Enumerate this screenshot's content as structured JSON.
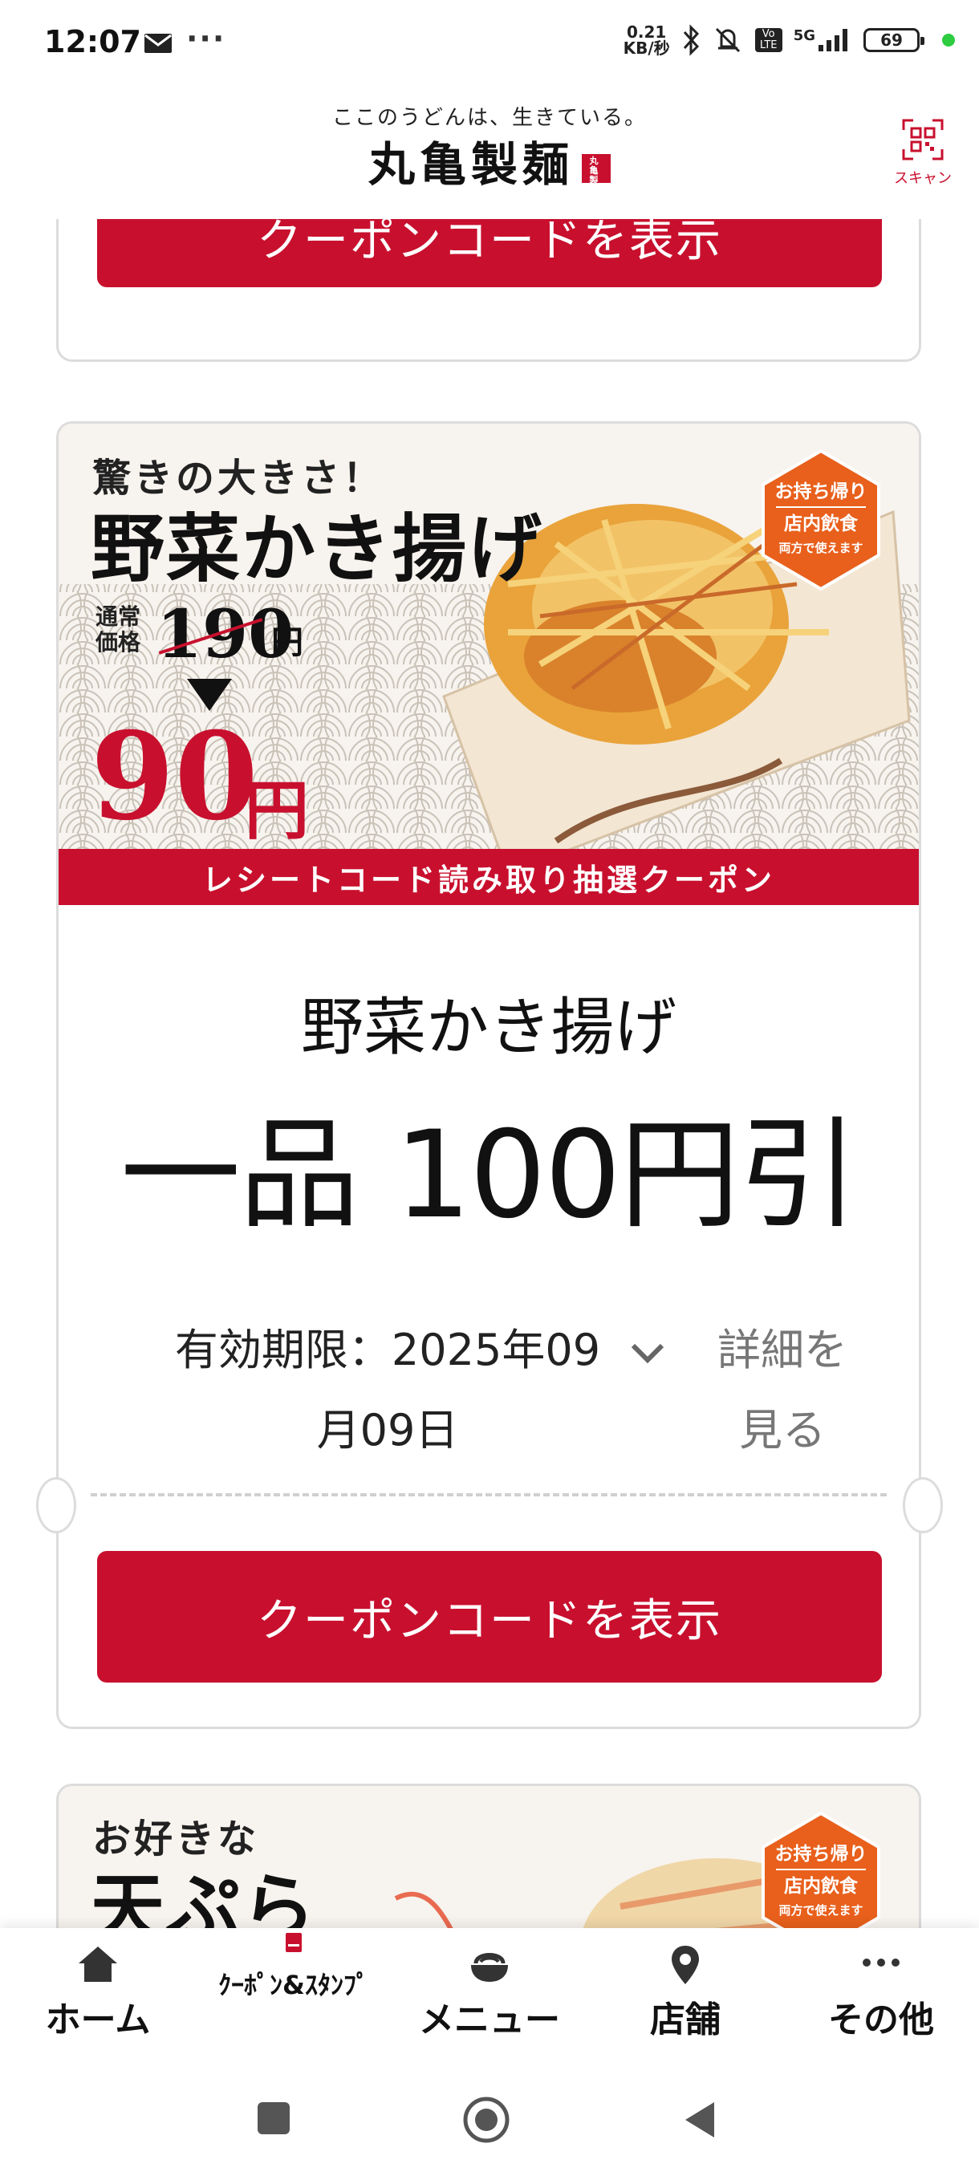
{
  "status_bar": {
    "time": "12:07",
    "dots": "···",
    "net_speed_value": "0.21",
    "net_speed_unit": "KB/秒",
    "volte": "Vo LTE",
    "network": "5G",
    "battery": "69"
  },
  "header": {
    "tagline": "ここのうどんは、生きている。",
    "brand": "丸亀製麺",
    "seal": "丸亀製麺",
    "scan_label": "スキャン"
  },
  "coupon_prev": {
    "button_label": "クーポンコードを表示"
  },
  "coupon_main": {
    "banner": {
      "catchphrase": "驚きの大きさ！",
      "product_name": "野菜かき揚げ",
      "normal_price_label": "通常価格",
      "normal_price": "190",
      "normal_price_unit": "円",
      "sale_price": "90",
      "sale_price_unit": "円",
      "badge_line1": "お持ち帰り",
      "badge_line2": "店内飲食",
      "badge_line3": "両方で使えます",
      "strip_text": "レシートコード読み取り抽選クーポン"
    },
    "title": "野菜かき揚げ",
    "value": "一品 100円引",
    "expiry_line1": "有効期限：2025年09",
    "expiry_line2": "月09日",
    "details_line1": "詳細を",
    "details_line2": "見る",
    "button_label": "クーポンコードを表示"
  },
  "coupon_next": {
    "banner": {
      "catchphrase": "お好きな",
      "product_name": "天ぷら",
      "badge_line1": "お持ち帰り",
      "badge_line2": "店内飲食",
      "badge_line3": "両方で使えます"
    }
  },
  "bottom_nav": {
    "items": [
      {
        "label": "ホーム",
        "icon": "home-icon"
      },
      {
        "label": "ｸｰﾎﾟﾝ&ｽﾀﾝﾌﾟ",
        "icon": "coupon-icon"
      },
      {
        "label": "メニュー",
        "icon": "bowl-icon"
      },
      {
        "label": "店舗",
        "icon": "location-pin-icon"
      },
      {
        "label": "その他",
        "icon": "more-icon"
      }
    ]
  },
  "colors": {
    "brand_red": "#c8102e",
    "badge_orange": "#e8601c"
  }
}
